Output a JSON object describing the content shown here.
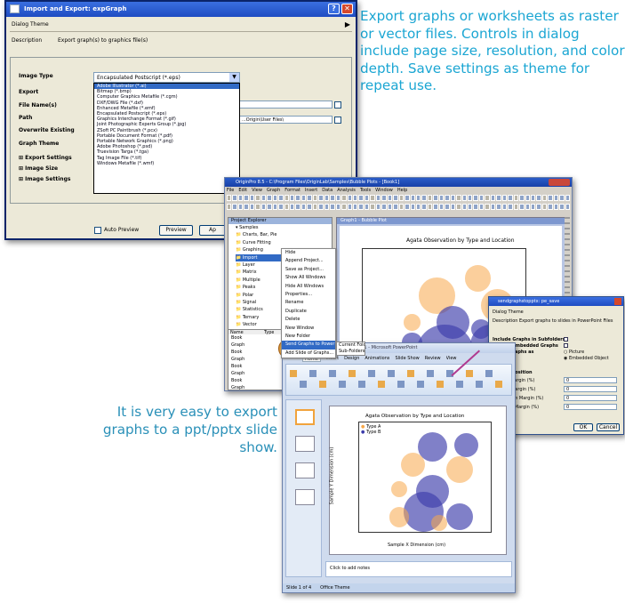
{
  "captions": {
    "top": "Export graphs or worksheets as raster or vector files. Controls in dialog include page size, resolution, and color depth. Save settings as theme for repeat use.",
    "bottom": "It is very easy to export graphs to a ppt/pptx slide show."
  },
  "colors": {
    "caption_top": "#1ba6d3",
    "caption_bottom": "#2a90b8",
    "title_bar": "#1f4cc2",
    "bubble_orange": "#f8a84a",
    "bubble_blue": "#3c3caa"
  },
  "export_dialog": {
    "title": "Import and Export: expGraph",
    "dialog_theme_label": "Dialog Theme",
    "description_label": "Description",
    "description_value": "Export graph(s) to graphics file(s)",
    "image_type_label": "Image Type",
    "image_type_value": "Encapsulated Postscript (*.eps)",
    "export_label": "Export",
    "file_name_label": "File Name(s)",
    "path_label": "Path",
    "path_value": "...Origin\\User Files\\",
    "overwrite_label": "Overwrite Existing",
    "graph_theme_label": "Graph Theme",
    "export_settings_label": "Export Settings",
    "image_size_label": "Image Size",
    "image_settings_label": "Image Settings",
    "auto_preview_label": "Auto Preview",
    "preview_button": "Preview",
    "apply_button": "Ap",
    "image_types": [
      "Adobe Illustrator (*.ai)",
      "Bitmap (*.bmp)",
      "Computer Graphics Metafile (*.cgm)",
      "DXF/DWG File (*.dxf)",
      "Enhanced Metafile (*.emf)",
      "Encapsulated Postscript (*.eps)",
      "Graphics Interchange Format (*.gif)",
      "Joint Photographic Experts Group (*.jpg)",
      "ZSoft PC Paintbrush (*.pcx)",
      "Portable Document Format (*.pdf)",
      "Portable Network Graphics (*.png)",
      "Adobe Photoshop (*.psd)",
      "Truevision Targa (*.tga)",
      "Tag Image File (*.tif)",
      "Windows Metafile (*.wmf)"
    ],
    "selected_index": 0
  },
  "origin_window": {
    "title": "OriginPro 8.5 - C:\\Program Files\\OriginLab\\Samples\\Bubble Plots - [Book1]",
    "menu": [
      "File",
      "Edit",
      "View",
      "Graph",
      "Format",
      "Insert",
      "Data",
      "Analysis",
      "Tools",
      "Window",
      "Help"
    ],
    "project_explorer_title": "Project Explorer",
    "tree": [
      "Samples",
      "Charts, Bar, Pie",
      "Curve Fitting",
      "Graphing",
      "Import",
      "Layer",
      "Matrix",
      "Multiple",
      "Peaks",
      "Polar",
      "Signal",
      "Statistics",
      "Ternary",
      "Vector"
    ],
    "list_header": [
      "Name",
      "Type"
    ],
    "list_rows": [
      "Book",
      "Graph",
      "Book",
      "Graph",
      "Book",
      "Graph",
      "Book",
      "Graph"
    ],
    "graph_window_title": "Graph1 - Bubble Plot",
    "context_menu": [
      "Hide",
      "Append Project...",
      "Save as Project...",
      "Show All Windows",
      "Hide All Windows",
      "Properties...",
      "Rename",
      "Duplicate",
      "Delete",
      "New Window",
      "New Folder",
      "Send Graphs to PowerPoint",
      "Add Slide of Graphs..."
    ],
    "submenu": [
      "Current Folder",
      "Sub-Folders"
    ],
    "chart": {
      "title": "Agata Observation by Type and Location",
      "xlabel": "",
      "ylabel": "Sample Y Dimension (cm)"
    }
  },
  "slide_dialog": {
    "title": "sendgraphstopptx: pe_save",
    "dialog_theme_label": "Dialog Theme",
    "description_label": "Description",
    "description_value": "Export graphs to slides in PowerPoint Files",
    "include_graphs_label": "Include Graphs in Subfolders",
    "include_embedded_label": "Include Embedded Graphs",
    "insert_graphs_label": "Insert Graphs as",
    "picture_label": "Picture",
    "embedded_label": "Embedded Object",
    "slide_position_label": "Slide Position",
    "top_margin_label": "Top Margin (%)",
    "left_margin_label": "Left Margin (%)",
    "bottom_margin_label": "Bottom Margin (%)",
    "right_margin_label": "Right Margin (%)",
    "margin_values": [
      "0",
      "0",
      "0",
      "0"
    ],
    "ok_button": "OK",
    "cancel_button": "Cancel"
  },
  "ppt_window": {
    "title": "Presentation1 - Microsoft PowerPoint",
    "tabs": [
      "Home",
      "Insert",
      "Design",
      "Animations",
      "Slide Show",
      "Review",
      "View"
    ],
    "chart": {
      "title": "Agata Observation by Type and Location",
      "legend": [
        "Type A",
        "Type B"
      ],
      "xlabel": "Sample X Dimension (cm)",
      "ylabel": "Sample Y Dimension (cm)"
    },
    "notes_placeholder": "Click to add notes",
    "status": [
      "Slide 1 of 4",
      "Office Theme"
    ]
  }
}
